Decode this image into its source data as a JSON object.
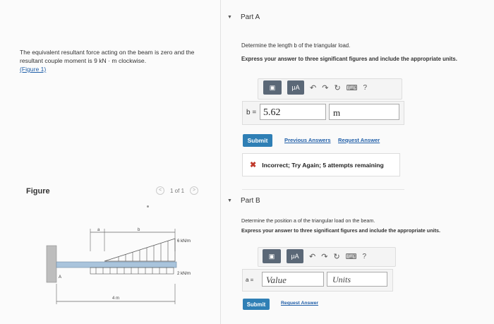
{
  "problem": {
    "text": "The equivalent resultant force acting on the beam is zero and the resultant couple moment is 9 kN · m clockwise.",
    "figure_link": "(Figure 1)"
  },
  "figure": {
    "title": "Figure",
    "pager": "1 of 1",
    "prev_icon": "chevron-left-icon",
    "next_icon": "chevron-right-icon",
    "labels": {
      "a": "a",
      "b": "b",
      "load_top": "6 kN/m",
      "load_bottom": "2 kN/m",
      "A": "A",
      "span": "4 m"
    }
  },
  "partA": {
    "title": "Part A",
    "prompt": "Determine the length b of the triangular load.",
    "instruction": "Express your answer to three significant figures and include the appropriate units.",
    "toolbar": {
      "matrix": "▣",
      "mu": "μA",
      "undo": "↶",
      "redo": "↷",
      "reset": "↻",
      "keyboard": "⌨",
      "help": "?"
    },
    "var_label": "b =",
    "value": "5.62",
    "units": "m",
    "submit": "Submit",
    "prev_answers": "Previous Answers",
    "request_answer": "Request Answer",
    "feedback": "Incorrect; Try Again; 5 attempts remaining"
  },
  "partB": {
    "title": "Part B",
    "prompt": "Determine the position a of the triangular load on the beam.",
    "instruction": "Express your answer to three significant figures and include the appropriate units.",
    "toolbar": {
      "matrix": "▣",
      "mu": "μA",
      "undo": "↶",
      "redo": "↷",
      "reset": "↻",
      "keyboard": "⌨",
      "help": "?"
    },
    "var_label": "a =",
    "value_placeholder": "Value",
    "units_placeholder": "Units",
    "submit": "Submit",
    "request_answer": "Request Answer"
  },
  "colors": {
    "accent": "#2f7fb5",
    "link": "#1f5ea8",
    "error": "#c0392b",
    "toolbar": "#5b6877"
  }
}
